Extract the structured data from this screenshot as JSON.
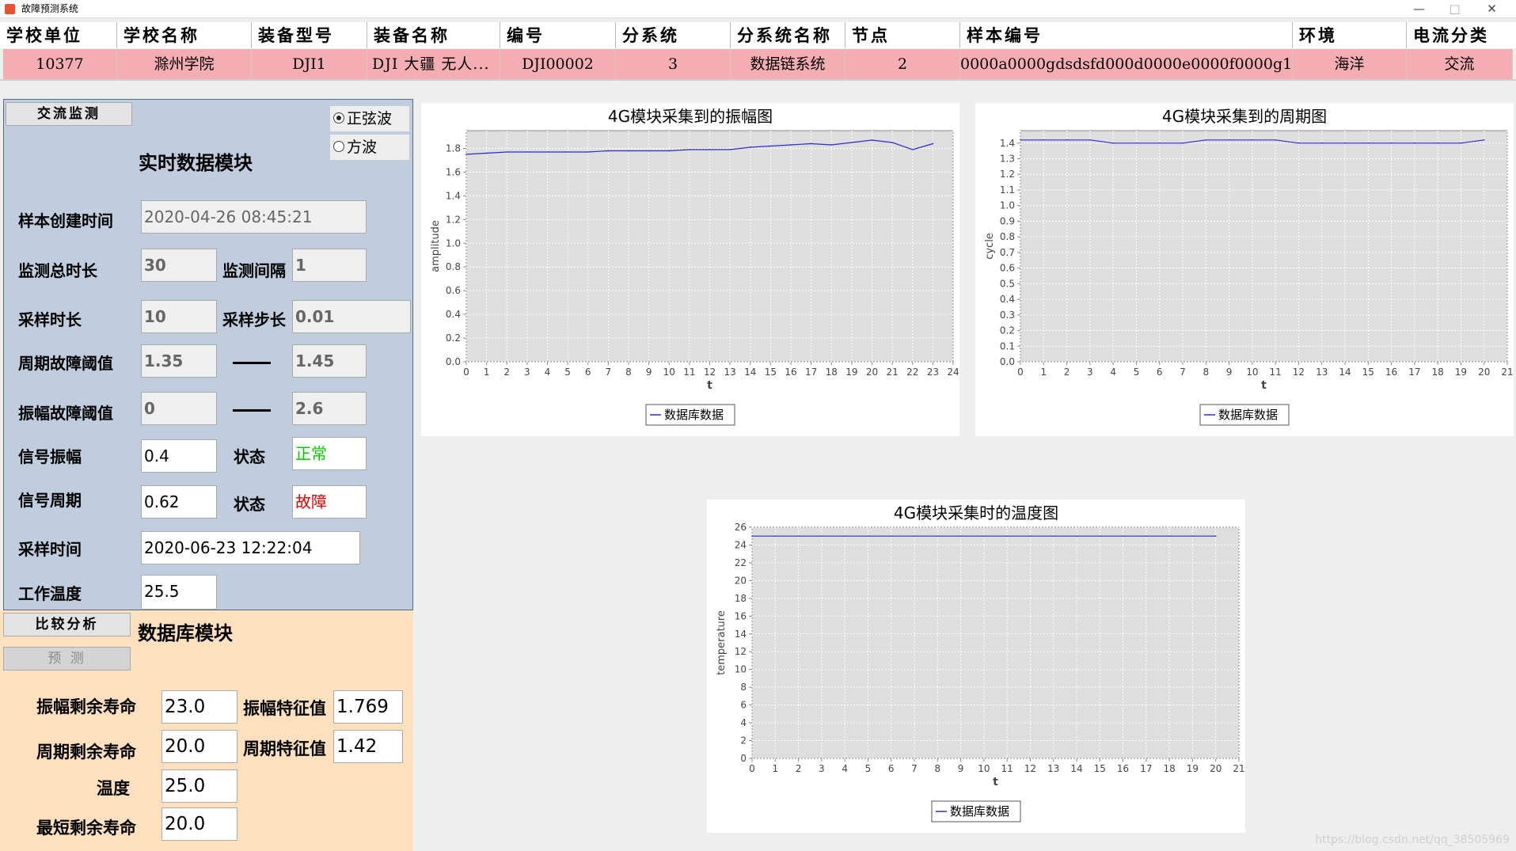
{
  "window": {
    "title": "故障预测系统",
    "min": "—",
    "max": "□",
    "close": "✕"
  },
  "table": {
    "headers": [
      "学校单位",
      "学校名称",
      "装备型号",
      "装备名称",
      "编号",
      "分系统",
      "分系统名称",
      "节点",
      "样本编号",
      "环境",
      "电流分类"
    ],
    "row": [
      "10377",
      "滁州学院",
      "DJI1",
      "DJI 大疆 无人...",
      "DJI00002",
      "3",
      "数据链系统",
      "2",
      "0000a0000gdsdsfd000d0000e0000f0000g11",
      "海洋",
      "交流"
    ]
  },
  "realtime": {
    "tab_label": "交流监测",
    "radio_sine": "正弦波",
    "radio_square": "方波",
    "title": "实时数据模块",
    "create_time_label": "样本创建时间",
    "create_time": "2020-04-26 08:45:21",
    "total_duration_label": "监测总时长",
    "total_duration": "30",
    "interval_label": "监测间隔",
    "interval": "1",
    "sample_duration_label": "采样时长",
    "sample_duration": "10",
    "sample_step_label": "采样步长",
    "sample_step": "0.01",
    "cycle_threshold_label": "周期故障阈值",
    "cycle_min": "1.35",
    "cycle_max": "1.45",
    "amp_threshold_label": "振幅故障阈值",
    "amp_min": "0",
    "amp_max": "2.6",
    "signal_amp_label": "信号振幅",
    "signal_amp": "0.4",
    "state_label": "状态",
    "state_amp": "正常",
    "signal_cycle_label": "信号周期",
    "signal_cycle": "0.62",
    "state_cycle": "故障",
    "sample_time_label": "采样时间",
    "sample_time": "2020-06-23 12:22:04",
    "work_temp_label": "工作温度",
    "work_temp": "25.5"
  },
  "database": {
    "compare_label": "比较分析",
    "predict_label": "预 测",
    "title": "数据库模块",
    "amp_life_label": "振幅剩余寿命",
    "amp_life": "23.0",
    "amp_feature_label": "振幅特征值",
    "amp_feature": "1.769",
    "cycle_life_label": "周期剩余寿命",
    "cycle_life": "20.0",
    "cycle_feature_label": "周期特征值",
    "cycle_feature": "1.42",
    "temp_label": "温度",
    "temp": "25.0",
    "min_life_label": "最短剩余寿命",
    "min_life": "20.0"
  },
  "colors": {
    "header_bg": "#ffffff",
    "row_bg": "#f4aeb3",
    "blue_panel": "#bfcdde",
    "orange_panel": "#fde0be",
    "plot_bg": "#dedede",
    "series": "#2a2ad8",
    "ok": "#00cc00",
    "fault": "#e00000"
  },
  "watermark": "https://blog.csdn.net/qq_38505969",
  "chart_data": [
    {
      "type": "line",
      "title": "4G模块采集到的振幅图",
      "xlabel": "t",
      "ylabel": "amplitude",
      "xlim": [
        0,
        24
      ],
      "ylim": [
        0,
        1.95
      ],
      "xticks": [
        0,
        1,
        2,
        3,
        4,
        5,
        6,
        7,
        8,
        9,
        10,
        11,
        12,
        13,
        14,
        15,
        16,
        17,
        18,
        19,
        20,
        21,
        22,
        23,
        24
      ],
      "yticks": [
        0.0,
        0.2,
        0.4,
        0.6,
        0.8,
        1.0,
        1.2,
        1.4,
        1.6,
        1.8
      ],
      "legend": "bottom",
      "series": [
        {
          "name": "数据库数据",
          "x": [
            0,
            1,
            2,
            3,
            4,
            5,
            6,
            7,
            8,
            9,
            10,
            11,
            12,
            13,
            14,
            15,
            16,
            17,
            18,
            19,
            20,
            21,
            22,
            23
          ],
          "y": [
            1.75,
            1.76,
            1.77,
            1.77,
            1.77,
            1.77,
            1.77,
            1.78,
            1.78,
            1.78,
            1.78,
            1.79,
            1.79,
            1.79,
            1.81,
            1.82,
            1.83,
            1.84,
            1.83,
            1.85,
            1.87,
            1.85,
            1.79,
            1.84
          ]
        }
      ]
    },
    {
      "type": "line",
      "title": "4G模块采集到的周期图",
      "xlabel": "t",
      "ylabel": "cycle",
      "xlim": [
        0,
        21
      ],
      "ylim": [
        0,
        1.48
      ],
      "xticks": [
        0,
        1,
        2,
        3,
        4,
        5,
        6,
        7,
        8,
        9,
        10,
        11,
        12,
        13,
        14,
        15,
        16,
        17,
        18,
        19,
        20,
        21
      ],
      "yticks": [
        0.0,
        0.1,
        0.2,
        0.3,
        0.4,
        0.5,
        0.6,
        0.7,
        0.8,
        0.9,
        1.0,
        1.1,
        1.2,
        1.3,
        1.4
      ],
      "legend": "bottom",
      "series": [
        {
          "name": "数据库数据",
          "x": [
            0,
            1,
            2,
            3,
            4,
            5,
            6,
            7,
            8,
            9,
            10,
            11,
            12,
            13,
            14,
            15,
            16,
            17,
            18,
            19,
            20
          ],
          "y": [
            1.42,
            1.42,
            1.42,
            1.42,
            1.4,
            1.4,
            1.4,
            1.4,
            1.42,
            1.42,
            1.42,
            1.42,
            1.4,
            1.4,
            1.4,
            1.4,
            1.4,
            1.4,
            1.4,
            1.4,
            1.42
          ]
        }
      ]
    },
    {
      "type": "line",
      "title": "4G模块采集时的温度图",
      "xlabel": "t",
      "ylabel": "temperature",
      "xlim": [
        0,
        21
      ],
      "ylim": [
        0,
        26
      ],
      "xticks": [
        0,
        1,
        2,
        3,
        4,
        5,
        6,
        7,
        8,
        9,
        10,
        11,
        12,
        13,
        14,
        15,
        16,
        17,
        18,
        19,
        20,
        21
      ],
      "yticks": [
        0,
        2,
        4,
        6,
        8,
        10,
        12,
        14,
        16,
        18,
        20,
        22,
        24,
        26
      ],
      "legend": "bottom",
      "series": [
        {
          "name": "数据库数据",
          "x": [
            0,
            1,
            2,
            3,
            4,
            5,
            6,
            7,
            8,
            9,
            10,
            11,
            12,
            13,
            14,
            15,
            16,
            17,
            18,
            19,
            20
          ],
          "y": [
            25,
            25,
            25,
            25,
            25,
            25,
            25,
            25,
            25,
            25,
            25,
            25,
            25,
            25,
            25,
            25,
            25,
            25,
            25,
            25,
            25
          ]
        }
      ]
    }
  ]
}
